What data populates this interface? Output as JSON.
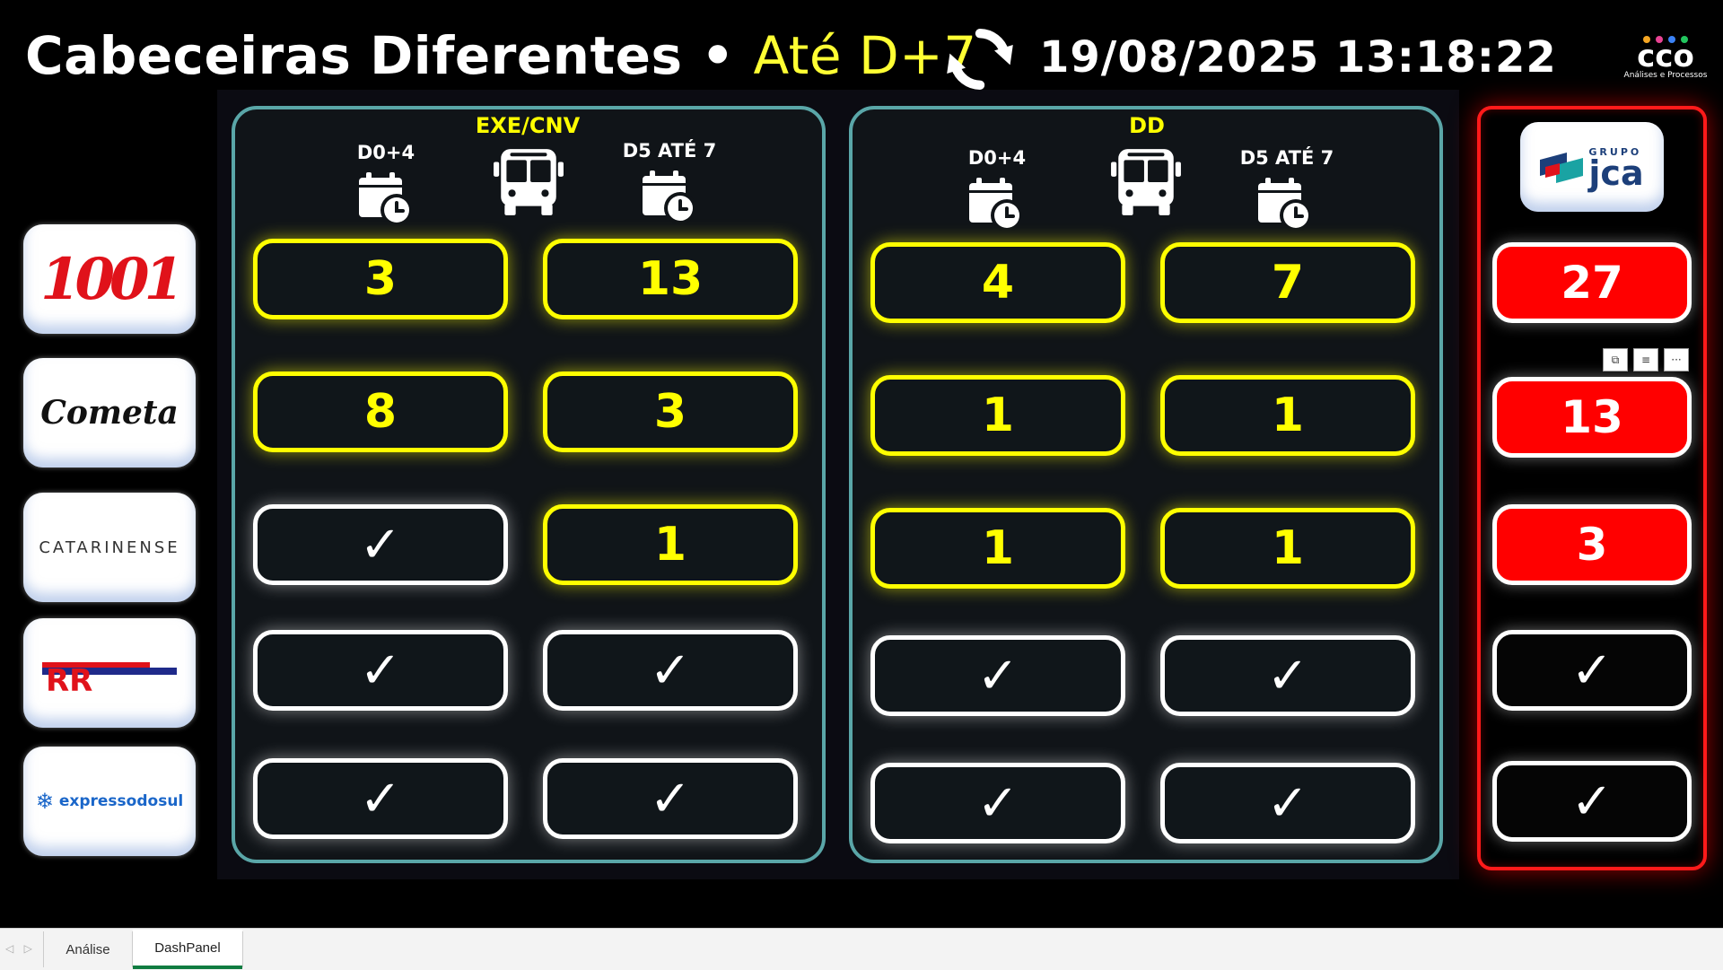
{
  "header": {
    "title": "Cabeceiras Diferentes •",
    "subtitle": "Até D+7",
    "datetime": "19/08/2025 13:18:22"
  },
  "brand": {
    "name": "CCO",
    "tagline": "Análises e Processos",
    "dot_colors": [
      "#f5a623",
      "#e84393",
      "#3b82f6",
      "#22c55e"
    ]
  },
  "companies": [
    "1001",
    "Cometa",
    "CATARINENSE",
    "RR",
    "expressodosul"
  ],
  "panels": [
    {
      "title": "EXE/CNV",
      "col1_label": "D0+4",
      "col2_label": "D5 ATÉ 7",
      "rows": [
        [
          "3",
          "13"
        ],
        [
          "8",
          "3"
        ],
        [
          "✓",
          "1"
        ],
        [
          "✓",
          "✓"
        ],
        [
          "✓",
          "✓"
        ]
      ]
    },
    {
      "title": "DD",
      "col1_label": "D0+4",
      "col2_label": "D5 ATÉ 7",
      "rows": [
        [
          "4",
          "7"
        ],
        [
          "1",
          "1"
        ],
        [
          "1",
          "1"
        ],
        [
          "✓",
          "✓"
        ],
        [
          "✓",
          "✓"
        ]
      ]
    }
  ],
  "totals": {
    "group_logo": {
      "top": "GRUPO",
      "word": "jca"
    },
    "values": [
      "27",
      "13",
      "3",
      "✓",
      "✓"
    ]
  },
  "tabs": [
    {
      "label": "Análise",
      "active": false
    },
    {
      "label": "DashPanel",
      "active": true
    }
  ],
  "colors": {
    "warn": "#ffff00",
    "alert": "#ff0000",
    "panel_border": "#5aa6a8"
  }
}
